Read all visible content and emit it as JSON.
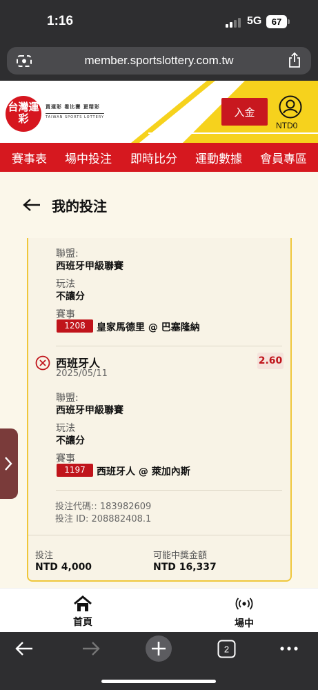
{
  "status_bar": {
    "time": "1:16",
    "network": "5G",
    "battery": "67"
  },
  "browser": {
    "url": "member.sportslottery.com.tw"
  },
  "site_header": {
    "logo_chinese": "台灣運彩",
    "logo_slogan": "買運彩 看比賽 更精彩",
    "logo_english": "TAIWAN SPORTS LOTTERY",
    "deposit_label": "入金",
    "balance": "NTD0",
    "brand_red": "#d6181f",
    "brand_yellow": "#f6d21d"
  },
  "nav": {
    "items": [
      "賽事表",
      "場中投注",
      "即時比分",
      "運動數據",
      "會員專區"
    ]
  },
  "page": {
    "title": "我的投注"
  },
  "bet": {
    "leg1": {
      "league_label": "聯盟:",
      "league": "西班牙甲級聯賽",
      "market_label": "玩法",
      "market": "不讓分",
      "event_label": "賽事",
      "event_code": "1208",
      "event": "皇家馬德里 @ 巴塞隆納"
    },
    "leg2": {
      "selection": "西班牙人",
      "date": "2025/05/11",
      "odds": "2.60",
      "status_icon": "lost-x-icon",
      "league_label": "聯盟:",
      "league": "西班牙甲級聯賽",
      "market_label": "玩法",
      "market": "不讓分",
      "event_label": "賽事",
      "event_code": "1197",
      "event": "西班牙人 @ 萊加內斯"
    },
    "code_line": "投注代碼:: 183982609",
    "id_line": "投注 ID: 208882408.1",
    "stake_label": "投注",
    "stake": "NTD 4,000",
    "payout_label": "可能中獎金額",
    "payout": "NTD 16,337"
  },
  "bottom_nav": {
    "home": "首頁",
    "live": "場中"
  }
}
